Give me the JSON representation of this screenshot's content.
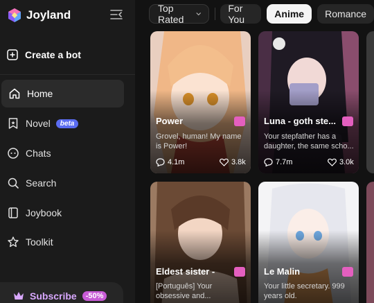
{
  "app": {
    "name": "Joyland"
  },
  "sidebar": {
    "create_bot": "Create a bot",
    "items": [
      {
        "label": "Home",
        "icon": "home-icon",
        "active": true
      },
      {
        "label": "Novel",
        "icon": "bookmark-icon",
        "badge": "beta"
      },
      {
        "label": "Chats",
        "icon": "chat-icon"
      },
      {
        "label": "Search",
        "icon": "search-icon"
      },
      {
        "label": "Joybook",
        "icon": "book-icon"
      },
      {
        "label": "Toolkit",
        "icon": "toolkit-icon"
      }
    ],
    "subscribe": {
      "label": "Subscribe",
      "discount": "-50%"
    }
  },
  "filters": {
    "sort": "Top Rated",
    "tabs": [
      "For You",
      "Anime",
      "Romance"
    ],
    "selected": "Anime"
  },
  "cards": [
    {
      "name": "Power",
      "desc": "Grovel, human! My name is Power!",
      "views": "4.1m",
      "likes": "3.8k"
    },
    {
      "name": "Luna - goth ste...",
      "desc": "Your stepfather has a daughter, the same scho...",
      "views": "7.7m",
      "likes": "3.0k"
    },
    {
      "name": "Eldest sister -",
      "desc": "[Português] Your obsessive and..."
    },
    {
      "name": "Le Malin",
      "desc": "Your little secretary. 999 years old."
    }
  ],
  "colors": {
    "accent_beta": "#5a6cf0",
    "subscribe": "#d9a8ff",
    "badge": "#e45fbf"
  }
}
